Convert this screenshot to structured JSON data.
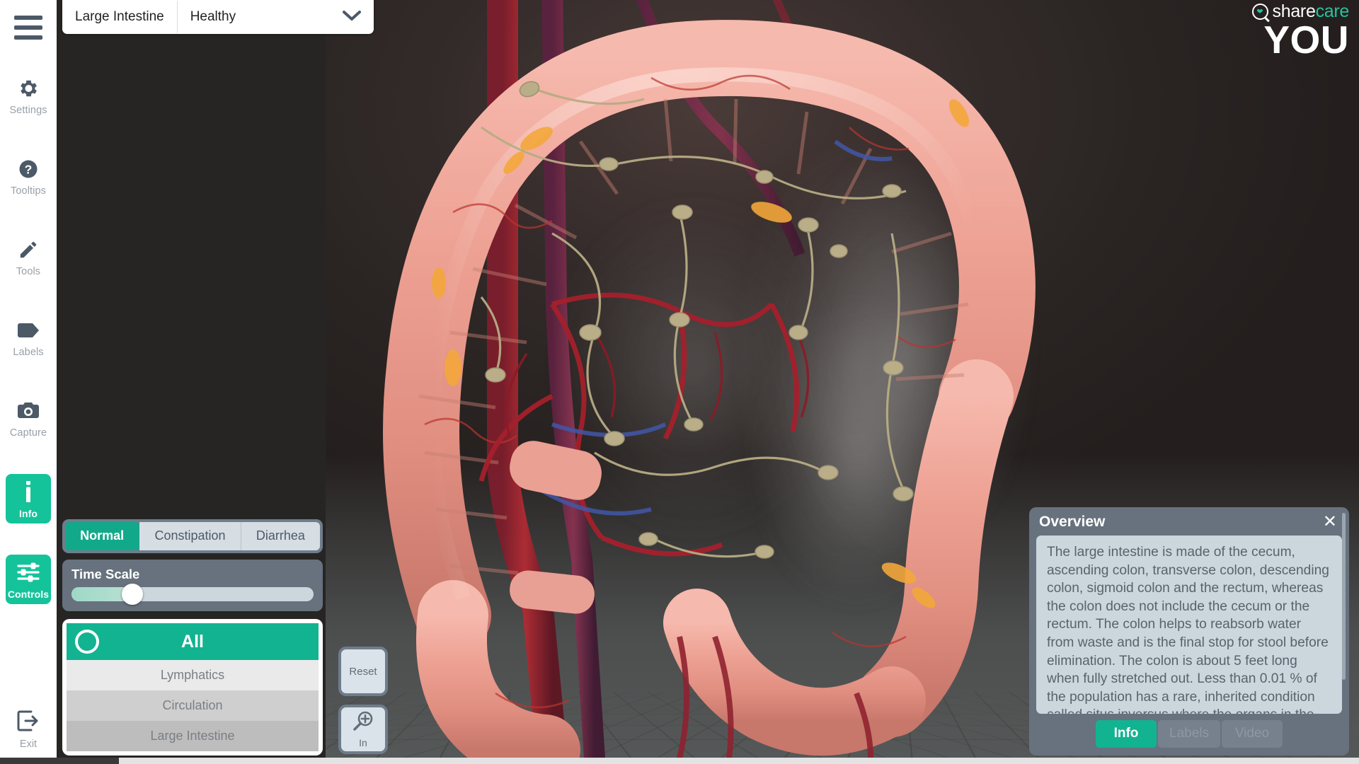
{
  "topbar": {
    "organ": "Large Intestine",
    "state": "Healthy",
    "chevron_icon": "chevron-down-icon"
  },
  "sidebar": {
    "menu_icon": "hamburger-menu-icon",
    "items": [
      {
        "label": "Settings",
        "icon": "gear-icon",
        "active": false
      },
      {
        "label": "Tooltips",
        "icon": "question-circle-icon",
        "active": false
      },
      {
        "label": "Tools",
        "icon": "pencil-icon",
        "active": false
      },
      {
        "label": "Labels",
        "icon": "tag-icon",
        "active": false
      },
      {
        "label": "Capture",
        "icon": "camera-icon",
        "active": false
      },
      {
        "label": "Info",
        "icon": "info-i-icon",
        "active": true
      },
      {
        "label": "Controls",
        "icon": "sliders-icon",
        "active": true
      }
    ],
    "exit": {
      "label": "Exit",
      "icon": "exit-arrow-icon"
    }
  },
  "controls": {
    "modes": [
      {
        "label": "Normal",
        "selected": true
      },
      {
        "label": "Constipation",
        "selected": false
      },
      {
        "label": "Diarrhea",
        "selected": false
      }
    ],
    "time_scale": {
      "label": "Time Scale",
      "value_percent": 22
    },
    "layers": [
      {
        "label": "All",
        "selected": true,
        "visibility_icon": "eye-circle-icon"
      },
      {
        "label": "Lymphatics",
        "selected": false
      },
      {
        "label": "Circulation",
        "selected": false
      },
      {
        "label": "Large Intestine",
        "selected": false
      }
    ]
  },
  "viewport_buttons": [
    {
      "label": "Reset",
      "icon": "reset-text"
    },
    {
      "label": "In",
      "icon": "magnifier-plus-icon"
    }
  ],
  "overview": {
    "title": "Overview",
    "close_icon": "close-icon",
    "body": "The large intestine is made of the cecum, ascending colon, transverse colon, descending colon, sigmoid colon and the rectum, whereas the colon does not include the cecum or the rectum. The colon helps to reabsorb water from waste and is the final stop for stool before elimination.  The colon is about 5 feet long when fully stretched out. Less than 0.01 % of the population has a rare, inherited condition called situs inversus where the organs in the abdominal cavity are",
    "tabs": [
      {
        "label": "Info",
        "selected": true
      },
      {
        "label": "Labels",
        "selected": false
      },
      {
        "label": "Video",
        "selected": false
      }
    ]
  },
  "logo": {
    "mark_icon": "sharecare-q-heart-icon",
    "word_share": "share",
    "word_care": "care",
    "word_you": "YOU"
  },
  "colors": {
    "accent_teal": "#12b391",
    "accent_teal_bright": "#15c39a",
    "panel_slate": "#67727e",
    "panel_light": "#ccd6dd",
    "sidebar_bg": "#ffffff",
    "scene_bg": "#2a2523"
  }
}
